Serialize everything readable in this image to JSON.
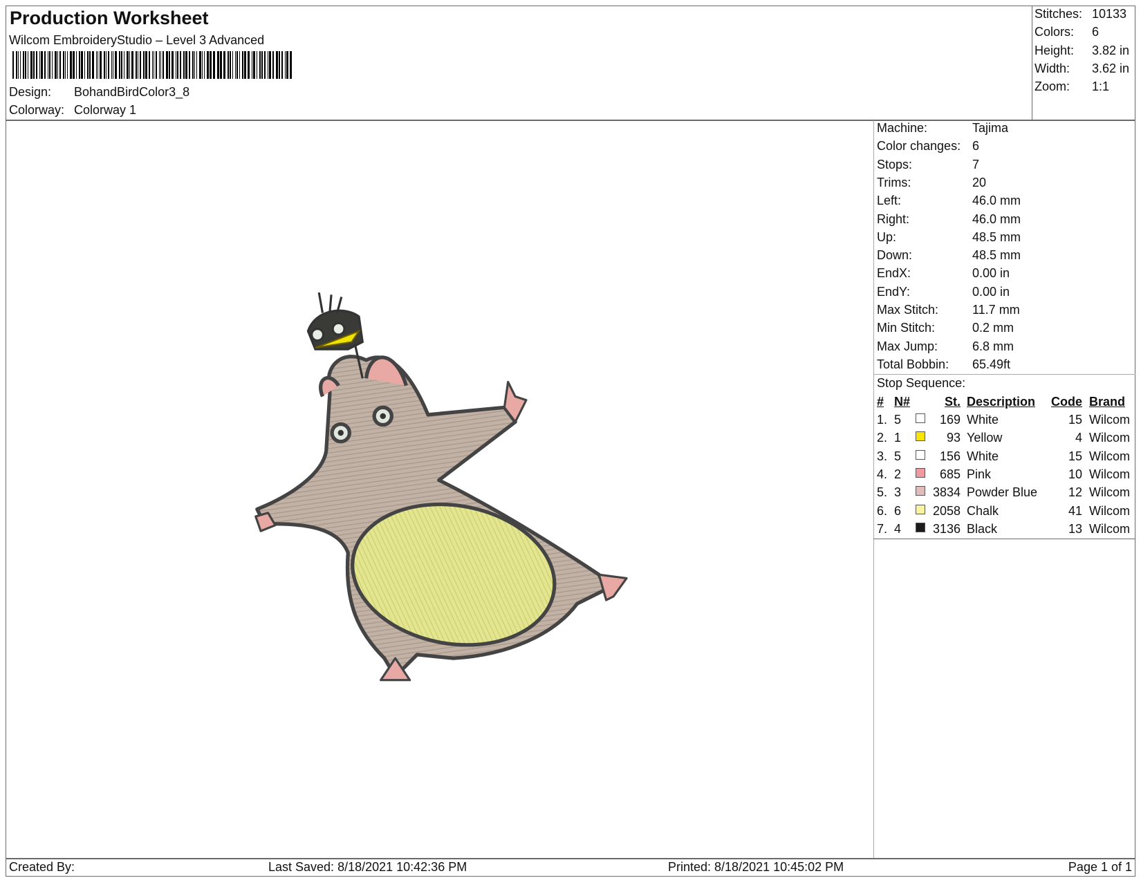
{
  "header": {
    "title": "Production Worksheet",
    "subtitle": "Wilcom EmbroideryStudio – Level 3 Advanced",
    "design_label": "Design:",
    "design_value": "BohandBirdColor3_8",
    "colorway_label": "Colorway:",
    "colorway_value": "Colorway 1"
  },
  "summary": [
    {
      "label": "Stitches:",
      "value": "10133"
    },
    {
      "label": "Colors:",
      "value": "6"
    },
    {
      "label": "Height:",
      "value": "3.82 in"
    },
    {
      "label": "Width:",
      "value": "3.62 in"
    },
    {
      "label": "Zoom:",
      "value": "1:1"
    }
  ],
  "details": [
    {
      "label": "Machine:",
      "value": "Tajima"
    },
    {
      "label": "Color changes:",
      "value": "6"
    },
    {
      "label": "Stops:",
      "value": "7"
    },
    {
      "label": "Trims:",
      "value": "20"
    },
    {
      "label": "Left:",
      "value": "46.0 mm"
    },
    {
      "label": "Right:",
      "value": "46.0 mm"
    },
    {
      "label": "Up:",
      "value": "48.5 mm"
    },
    {
      "label": "Down:",
      "value": "48.5 mm"
    },
    {
      "label": "EndX:",
      "value": "0.00 in"
    },
    {
      "label": "EndY:",
      "value": "0.00 in"
    },
    {
      "label": "Max Stitch:",
      "value": "11.7 mm"
    },
    {
      "label": "Min Stitch:",
      "value": "0.2 mm"
    },
    {
      "label": "Max Jump:",
      "value": "6.8 mm"
    },
    {
      "label": "Total Bobbin:",
      "value": "65.49ft"
    }
  ],
  "stop_sequence": {
    "title": "Stop Sequence:",
    "columns": [
      "#",
      "N#",
      "St.",
      "Description",
      "Code",
      "Brand"
    ],
    "rows": [
      {
        "num": "1.",
        "n": "5",
        "color": "#ffffff",
        "st": "169",
        "desc": "White",
        "code": "15",
        "brand": "Wilcom"
      },
      {
        "num": "2.",
        "n": "1",
        "color": "#f7e400",
        "st": "93",
        "desc": "Yellow",
        "code": "4",
        "brand": "Wilcom"
      },
      {
        "num": "3.",
        "n": "5",
        "color": "#ffffff",
        "st": "156",
        "desc": "White",
        "code": "15",
        "brand": "Wilcom"
      },
      {
        "num": "4.",
        "n": "2",
        "color": "#ee9aa0",
        "st": "685",
        "desc": "Pink",
        "code": "10",
        "brand": "Wilcom"
      },
      {
        "num": "5.",
        "n": "3",
        "color": "#e2bcbc",
        "st": "3834",
        "desc": "Powder Blue",
        "code": "12",
        "brand": "Wilcom"
      },
      {
        "num": "6.",
        "n": "6",
        "color": "#f7f3a0",
        "st": "2058",
        "desc": "Chalk",
        "code": "41",
        "brand": "Wilcom"
      },
      {
        "num": "7.",
        "n": "4",
        "color": "#1c1a1a",
        "st": "3136",
        "desc": "Black",
        "code": "13",
        "brand": "Wilcom"
      }
    ]
  },
  "footer": {
    "created_by": "Created By:",
    "last_saved": "Last Saved: 8/18/2021 10:42:36 PM",
    "printed": "Printed: 8/18/2021 10:45:02 PM",
    "page": "Page 1 of 1"
  }
}
